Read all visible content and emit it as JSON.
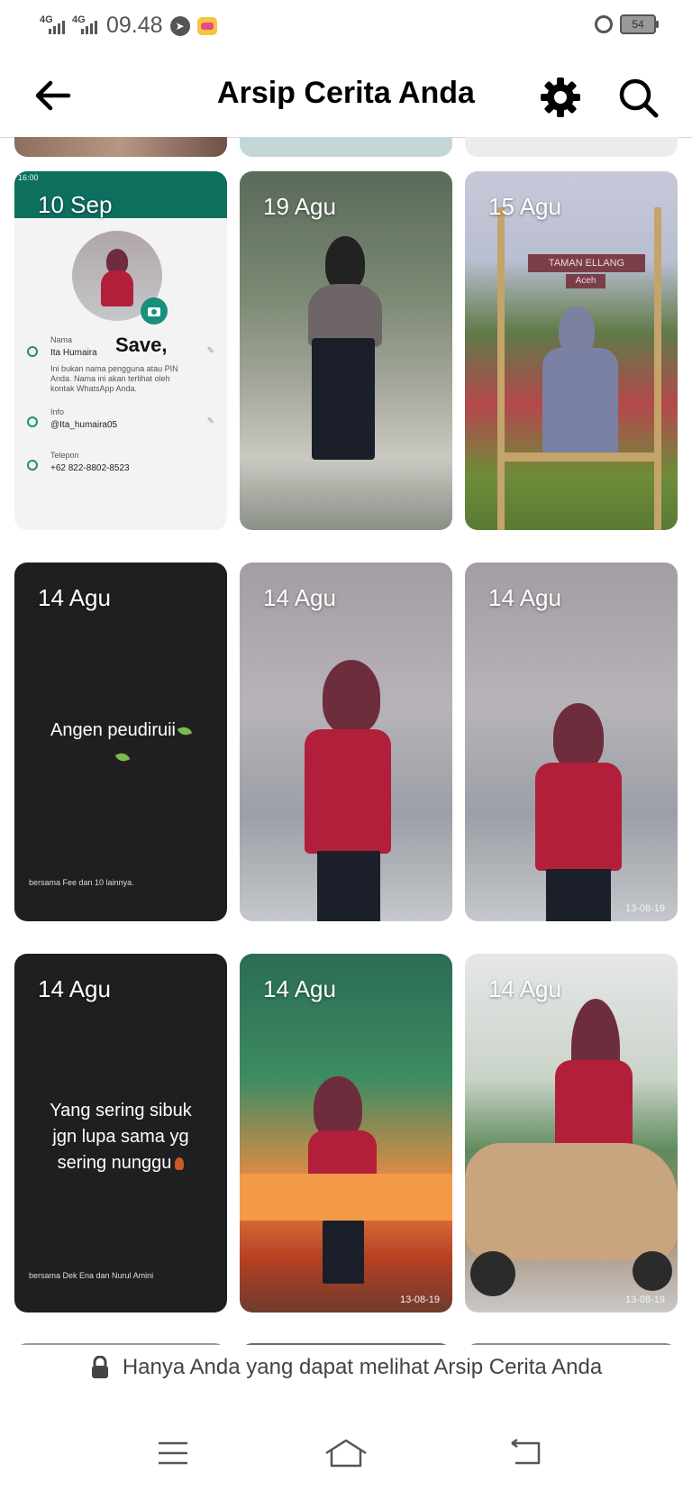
{
  "status_bar": {
    "network_1": "4G",
    "network_2": "4G",
    "time": "09.48",
    "battery": "54"
  },
  "header": {
    "title": "Arsip Cerita Anda"
  },
  "stories": [
    {
      "date": "10 Sep",
      "whatsapp": {
        "status_time": "16:00",
        "save_text": "Save,",
        "name_label": "Nama",
        "name_value": "Ita Humaira",
        "name_hint": "Ini bukan nama pengguna atau PIN Anda. Nama ini akan terlihat oleh kontak WhatsApp Anda.",
        "info_label": "Info",
        "info_value": "@Ita_humaira05",
        "phone_label": "Telepon",
        "phone_value": "+62 822-8802-8523"
      }
    },
    {
      "date": "19 Agu"
    },
    {
      "date": "15 Agu",
      "sign_1": "TAMAN ELLANG",
      "sign_2": "Aceh"
    },
    {
      "date": "14 Agu",
      "text": "Angen peudiruii",
      "with": "bersama Fee dan 10 lainnya."
    },
    {
      "date": "14 Agu"
    },
    {
      "date": "14 Agu",
      "stamp": "13-08-19"
    },
    {
      "date": "14 Agu",
      "text_lines": [
        "Yang sering sibuk",
        "jgn lupa sama yg",
        "sering nunggu"
      ],
      "with": "bersama Dek Ena dan Nurul Amini"
    },
    {
      "date": "14 Agu",
      "stamp": "13-08-19"
    },
    {
      "date": "14 Agu",
      "stamp": "13-08-19"
    }
  ],
  "footer": {
    "privacy_text": "Hanya Anda yang dapat melihat Arsip Cerita Anda"
  }
}
